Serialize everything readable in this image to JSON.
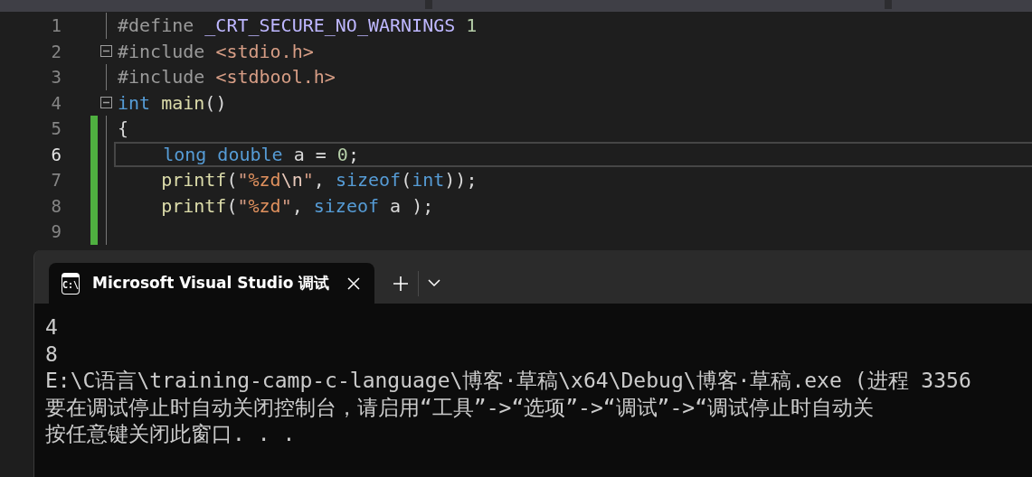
{
  "editor": {
    "lines": [
      {
        "number": "1",
        "current": false,
        "modified": false,
        "collapsible": false,
        "tokens": [
          {
            "kind": "preproc",
            "text": "#define "
          },
          {
            "kind": "macro",
            "text": "_CRT_SECURE_NO_WARNINGS"
          },
          {
            "kind": "number",
            "text": " 1"
          }
        ]
      },
      {
        "number": "2",
        "current": false,
        "modified": false,
        "collapsible": true,
        "tokens": [
          {
            "kind": "preproc",
            "text": "#include "
          },
          {
            "kind": "string",
            "text": "<stdio.h>"
          }
        ]
      },
      {
        "number": "3",
        "current": false,
        "modified": false,
        "collapsible": false,
        "tokens": [
          {
            "kind": "preproc",
            "text": "#include "
          },
          {
            "kind": "string",
            "text": "<stdbool.h>"
          }
        ]
      },
      {
        "number": "4",
        "current": false,
        "modified": false,
        "collapsible": true,
        "tokens": [
          {
            "kind": "keyword",
            "text": "int"
          },
          {
            "kind": "function",
            "text": " main"
          },
          {
            "kind": "plain",
            "text": "()"
          }
        ]
      },
      {
        "number": "5",
        "current": false,
        "modified": true,
        "collapsible": false,
        "tokens": [
          {
            "kind": "plain",
            "text": "{"
          }
        ]
      },
      {
        "number": "6",
        "current": true,
        "modified": true,
        "collapsible": false,
        "tokens": [
          {
            "kind": "keyword",
            "text": "    long double"
          },
          {
            "kind": "plain",
            "text": " a = "
          },
          {
            "kind": "number",
            "text": "0"
          },
          {
            "kind": "plain",
            "text": ";"
          }
        ]
      },
      {
        "number": "7",
        "current": false,
        "modified": true,
        "collapsible": false,
        "tokens": [
          {
            "kind": "function",
            "text": "    printf"
          },
          {
            "kind": "plain",
            "text": "("
          },
          {
            "kind": "string",
            "text": "\""
          },
          {
            "kind": "format",
            "text": "%zd"
          },
          {
            "kind": "escape",
            "text": "\\n"
          },
          {
            "kind": "string",
            "text": "\""
          },
          {
            "kind": "plain",
            "text": ", "
          },
          {
            "kind": "keyword",
            "text": "sizeof"
          },
          {
            "kind": "plain",
            "text": "("
          },
          {
            "kind": "keyword",
            "text": "int"
          },
          {
            "kind": "plain",
            "text": "));"
          }
        ]
      },
      {
        "number": "8",
        "current": false,
        "modified": true,
        "collapsible": false,
        "tokens": [
          {
            "kind": "function",
            "text": "    printf"
          },
          {
            "kind": "plain",
            "text": "("
          },
          {
            "kind": "string",
            "text": "\""
          },
          {
            "kind": "format",
            "text": "%zd"
          },
          {
            "kind": "string",
            "text": "\""
          },
          {
            "kind": "plain",
            "text": ", "
          },
          {
            "kind": "keyword",
            "text": "sizeof"
          },
          {
            "kind": "plain",
            "text": " a );"
          }
        ]
      },
      {
        "number": "9",
        "current": false,
        "modified": true,
        "collapsible": false
      }
    ]
  },
  "terminal": {
    "tab": {
      "icon_label": "C:\\",
      "title": "Microsoft Visual Studio 调试",
      "selected": true
    },
    "output": [
      "4",
      "8",
      "E:\\C语言\\training-camp-c-language\\博客·草稿\\x64\\Debug\\博客·草稿.exe (进程 3356",
      "要在调试停止时自动关闭控制台，请启用“工具”->“选项”->“调试”->“调试停止时自动关",
      "按任意键关闭此窗口. . ."
    ]
  }
}
